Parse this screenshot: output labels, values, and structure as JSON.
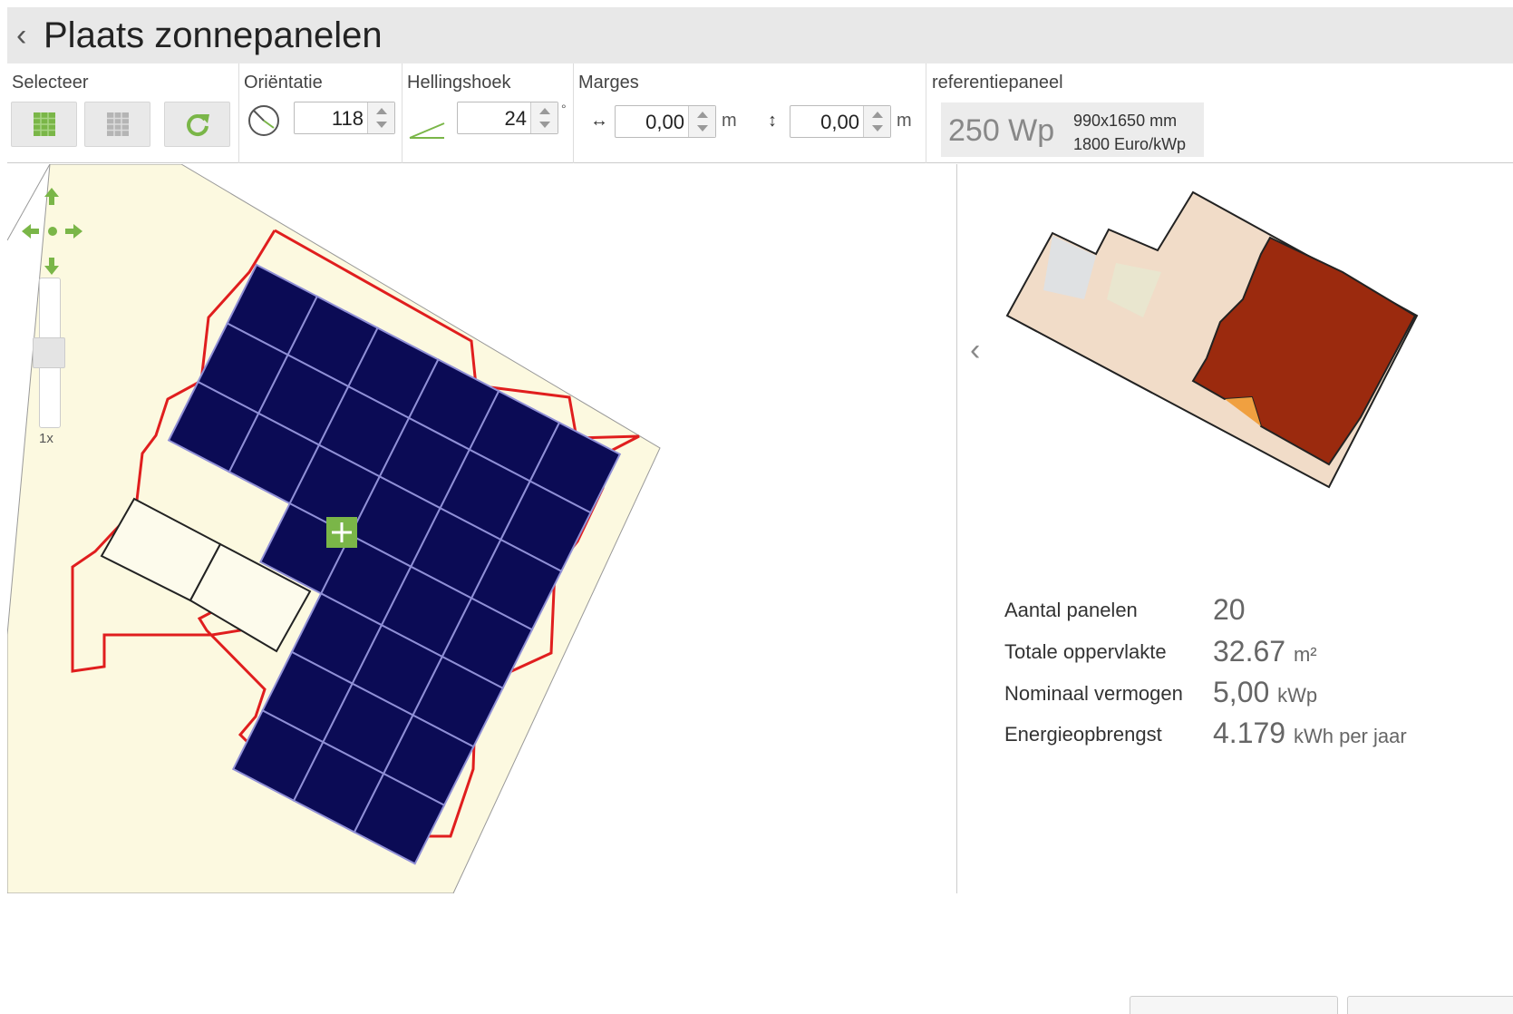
{
  "header": {
    "title": "Plaats zonnepanelen"
  },
  "toolbar": {
    "select": {
      "label": "Selecteer"
    },
    "orientation": {
      "label": "Oriëntatie",
      "value": "118"
    },
    "tilt": {
      "label": "Hellingshoek",
      "value": "24",
      "unit": "°"
    },
    "margins": {
      "label": "Marges",
      "horizontal": "0,00",
      "vertical": "0,00",
      "unit": "m"
    },
    "reference": {
      "label": "referentiepaneel",
      "power": "250 Wp",
      "size": "990x1650 mm",
      "price": "1800 Euro/kWp"
    }
  },
  "map": {
    "zoom_label": "1x"
  },
  "stats": {
    "panel_count": {
      "label": "Aantal panelen",
      "value": "20"
    },
    "total_area": {
      "label": "Totale oppervlakte",
      "value": "32.67",
      "unit": "m²"
    },
    "nominal_power": {
      "label": "Nominaal vermogen",
      "value": "5,00",
      "unit": "kWp"
    },
    "energy_yield": {
      "label": "Energieopbrengst",
      "value": "4.179",
      "unit": "kWh per jaar"
    }
  },
  "colors": {
    "accent_green": "#7ab648",
    "panel_navy": "#0b0b55",
    "roof_outline_red": "#e01e1e",
    "roof_fill": "#fcf9e0",
    "heat_dark": "#9b2a0e"
  }
}
